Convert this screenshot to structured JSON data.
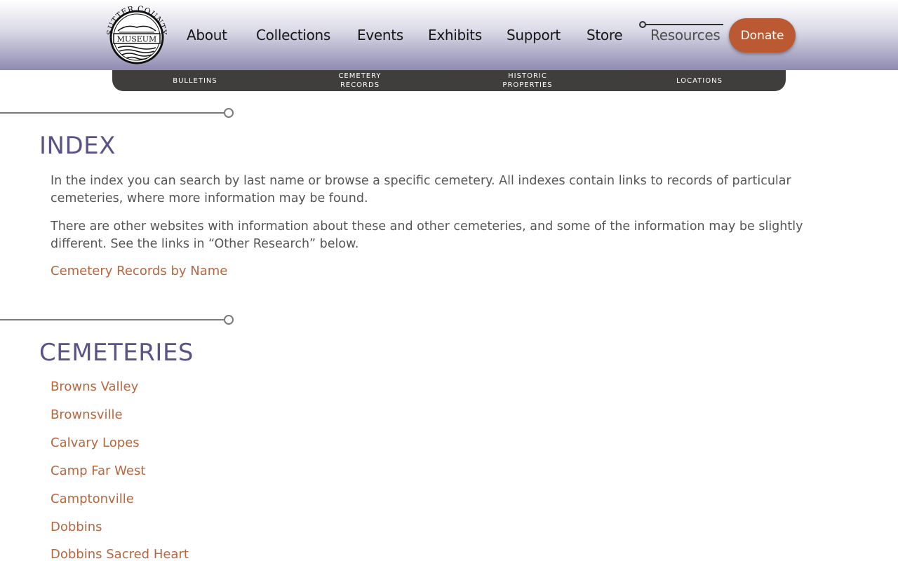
{
  "logo": {
    "top_text": "SUTTER COUNTY",
    "center_text": "MUSEUM"
  },
  "nav": {
    "items": [
      "About",
      "Collections",
      "Events",
      "Exhibits",
      "Support",
      "Store",
      "Resources"
    ],
    "active": "Resources",
    "donate_label": "Donate"
  },
  "subnav": {
    "items": [
      "BULLETINS",
      "CEMETERY\nRECORDS",
      "HISTORIC\nPROPERTIES",
      "LOCATIONS"
    ]
  },
  "index": {
    "title": "INDEX",
    "paragraph1": "In the index you can search by last name or browse a specific cemetery. All indexes contain links to records of particular cemeteries, where more information may be found.",
    "paragraph2": "There are other websites with information about these and other cemeteries, and some of the information may be slightly different. See the links in “Other Research” below.",
    "link": "Cemetery Records by Name"
  },
  "cemeteries": {
    "title": "CEMETERIES",
    "links": [
      "Browns Valley",
      "Brownsville",
      "Calvary Lopes",
      "Camp Far West",
      "Camptonville",
      "Dobbins",
      "Dobbins Sacred Heart"
    ]
  },
  "colors": {
    "accent": "#bb5a32",
    "link": "#b8663f",
    "heading": "#5a5388",
    "subnav_bg": "#403e3c"
  }
}
